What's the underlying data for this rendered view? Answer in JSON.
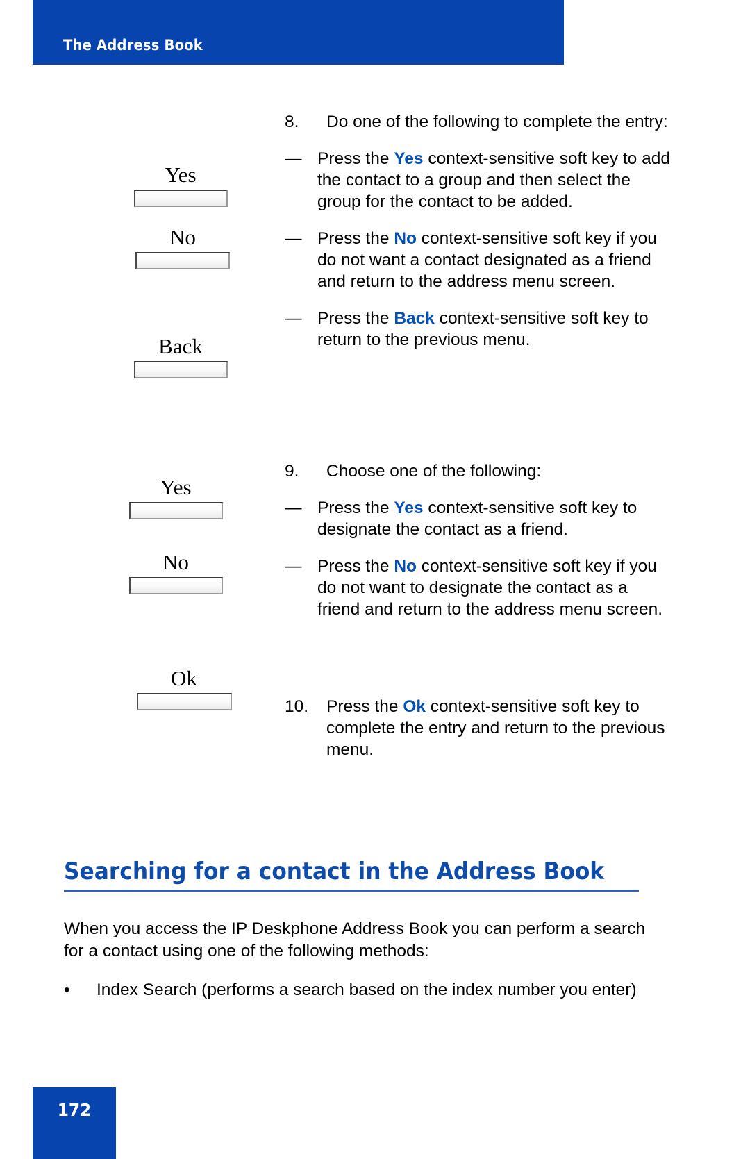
{
  "header": {
    "title": "The Address Book"
  },
  "colors": {
    "brand_blue": "#0844ad",
    "heading_blue": "#0f4ba8",
    "keyword_blue": "#0550b5",
    "rule_blue": "#2f61ae"
  },
  "softkeys": [
    {
      "label": "Yes"
    },
    {
      "label": "No"
    },
    {
      "label": "Back"
    },
    {
      "label": "Yes"
    },
    {
      "label": "No"
    },
    {
      "label": "Ok"
    }
  ],
  "steps": [
    {
      "number": "8.",
      "text": "Do one of the following to complete the entry:",
      "subitems": [
        {
          "dash": "—",
          "pre": "Press the ",
          "keyword": "Yes",
          "post": " context-sensitive soft key to add the contact to a group and then select the group for the contact to be added."
        },
        {
          "dash": "—",
          "pre": "Press the ",
          "keyword": "No",
          "post": " context-sensitive soft key if you do not want a contact designated as a friend and return to the address menu screen."
        },
        {
          "dash": "—",
          "pre": "Press the ",
          "keyword": "Back",
          "post": " context-sensitive soft key to return to the previous menu."
        }
      ]
    },
    {
      "number": "9.",
      "text": "Choose one of the following:",
      "subitems": [
        {
          "dash": "—",
          "pre": "Press the ",
          "keyword": "Yes",
          "post": " context-sensitive soft key to designate the contact as a friend."
        },
        {
          "dash": "—",
          "pre": "Press the ",
          "keyword": "No",
          "post": " context-sensitive soft key if you do not want to designate the contact as a friend and return to the address menu screen."
        }
      ]
    },
    {
      "number": "10.",
      "pre": "Press the ",
      "keyword": "Ok",
      "post": " context-sensitive soft key to complete the entry and return to the previous menu.",
      "subitems": []
    }
  ],
  "section": {
    "heading": "Searching for a contact in the Address Book",
    "paragraph": "When you access the IP Deskphone Address Book you can perform a search for a contact using one of the following methods:",
    "bullets": [
      {
        "marker": "•",
        "text": "Index Search (performs a search based on the index number you enter)"
      }
    ]
  },
  "footer": {
    "page_number": "172"
  }
}
